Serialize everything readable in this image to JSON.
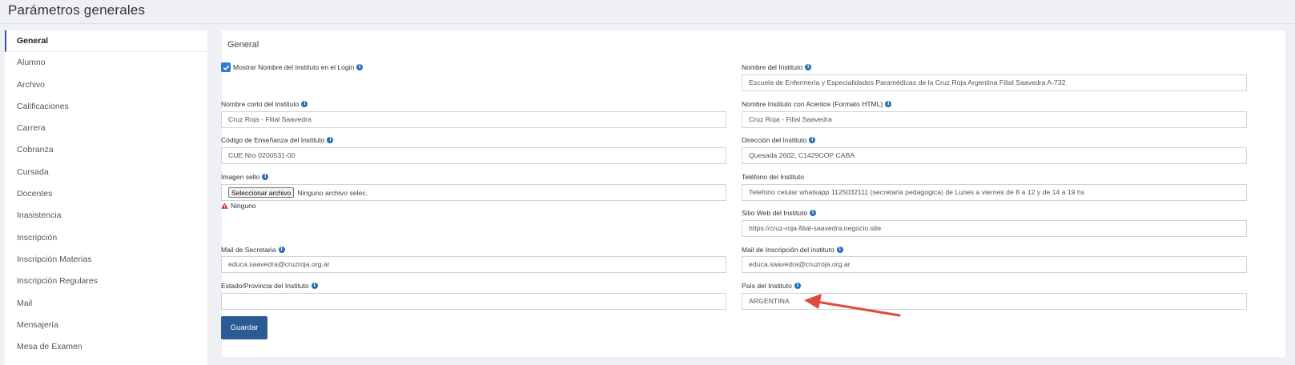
{
  "page": {
    "title": "Parámetros generales"
  },
  "sidebar": {
    "items": [
      {
        "label": "General"
      },
      {
        "label": "Alumno"
      },
      {
        "label": "Archivo"
      },
      {
        "label": "Calificaciones"
      },
      {
        "label": "Carrera"
      },
      {
        "label": "Cobranza"
      },
      {
        "label": "Cursada"
      },
      {
        "label": "Docentes"
      },
      {
        "label": "Inasistencia"
      },
      {
        "label": "Inscripción"
      },
      {
        "label": "Inscripción Materias"
      },
      {
        "label": "Inscripción Regulares"
      },
      {
        "label": "Mail"
      },
      {
        "label": "Mensajería"
      },
      {
        "label": "Mesa de Examen"
      }
    ]
  },
  "form": {
    "section_title": "General",
    "show_name_login": {
      "label": "Mostrar Nombre del Instituto en el Login",
      "checked": true
    },
    "nombre_instituto": {
      "label": "Nombre del Instituto",
      "value": "Escuela de Enfermería y Especialidades Paramédicas de la Cruz Roja Argentina Filial Saavedra A-732"
    },
    "nombre_corto": {
      "label": "Nombre corto del Instituto",
      "value": "Cruz Roja - Filial Saavedra"
    },
    "nombre_acentos": {
      "label": "Nombre Instituto con Acentos (Formato HTML)",
      "value": "Cruz Roja - Filial Saavedra"
    },
    "codigo_ensenanza": {
      "label": "Código de Enseñanza del Instituto",
      "value": "CUE Nro 0200531-00"
    },
    "direccion": {
      "label": "Dirección del Instituto",
      "value": "Quesada 2602, C1429COP CABA"
    },
    "imagen_sello": {
      "label": "Imagen sello",
      "button": "Seleccionar archivo",
      "file_text": "Ninguno archivo selec.",
      "status": "Ninguno"
    },
    "telefono": {
      "label": "Teléfono del Instituto",
      "value": "Telefono celular whatsapp 1125032111 (secretaria pedagogica) de Lunes a viernes de 8 a 12 y de 14 a 19 hs"
    },
    "sitio_web": {
      "label": "Sitio Web del Instituto",
      "value": "https://cruz-roja-filial-saavedra.negocio.site"
    },
    "mail_secretaria": {
      "label": "Mail de Secretaria",
      "value": "educa.saavedra@cruzroja.org.ar"
    },
    "mail_inscripcion": {
      "label": "Mail de Inscripción del instituto",
      "value": "educa.saavedra@cruzroja.org.ar"
    },
    "estado_provincia": {
      "label": "Estado/Provincia del Instituto",
      "value": ""
    },
    "pais": {
      "label": "País del Instituto",
      "value": "ARGENTINA"
    },
    "save_label": "Guardar"
  },
  "colors": {
    "accent": "#2b5a94",
    "info": "#2a6db3",
    "arrow": "#e04a3a",
    "warning": "#d9302c"
  }
}
